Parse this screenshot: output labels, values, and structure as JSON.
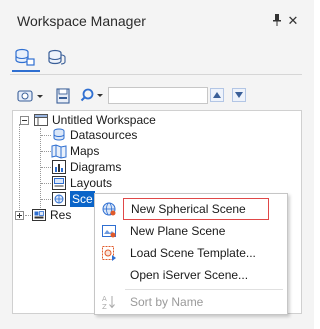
{
  "window": {
    "title": "Workspace Manager",
    "pin_glyph": "📌",
    "close_glyph": "✕"
  },
  "tabs": [
    {
      "name": "workspace-tree-tab",
      "icon": "database-tree-icon",
      "active": true
    },
    {
      "name": "datasource-tab",
      "icon": "database-stack-icon",
      "active": false
    }
  ],
  "toolbar": {
    "search_value": "",
    "open_workspace_icon": "workspace-open-icon",
    "save_icon": "save-icon",
    "search_icon": "search-icon",
    "up_icon": "triangle-up-icon",
    "down_icon": "triangle-down-icon"
  },
  "tree": {
    "root": "Untitled Workspace",
    "items": [
      {
        "label": "Datasources",
        "icon": "datasources-icon"
      },
      {
        "label": "Maps",
        "icon": "maps-icon"
      },
      {
        "label": "Diagrams",
        "icon": "diagrams-icon"
      },
      {
        "label": "Layouts",
        "icon": "layouts-icon"
      },
      {
        "label": "Sce",
        "icon": "scenes-icon",
        "selected": true
      },
      {
        "label": "Res",
        "icon": "resources-icon"
      }
    ]
  },
  "context_menu": {
    "items": [
      {
        "label": "New Spherical Scene",
        "icon": "globe-scene-icon",
        "highlighted": true
      },
      {
        "label": "New Plane Scene",
        "icon": "plane-scene-icon"
      },
      {
        "label": "Load Scene Template...",
        "icon": "scene-template-icon"
      },
      {
        "label": "Open iServer Scene...",
        "icon": ""
      },
      {
        "label": "Sort by Name",
        "icon": "sort-az-icon",
        "disabled": true
      }
    ]
  },
  "colors": {
    "accent": "#2f6fd1",
    "selection": "#0a64c8",
    "highlight_border": "#e04848"
  }
}
